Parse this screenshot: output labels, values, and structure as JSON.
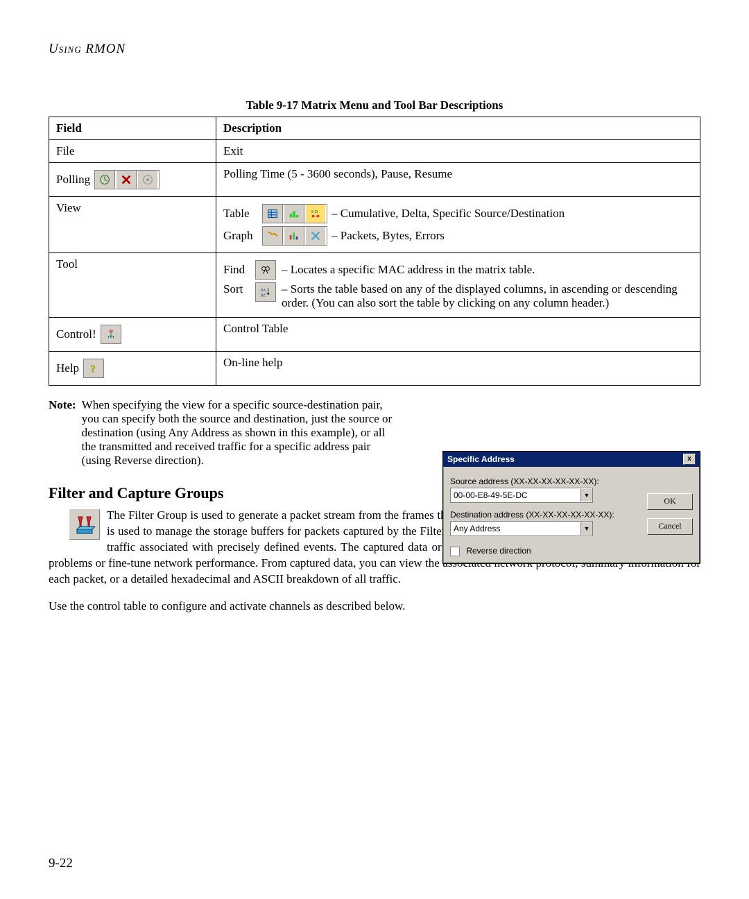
{
  "header": {
    "title": "Using RMON"
  },
  "table": {
    "caption": "Table 9-17  Matrix Menu and Tool Bar Descriptions",
    "headers": {
      "field": "Field",
      "description": "Description"
    },
    "rows": {
      "file": {
        "field": "File",
        "desc": "Exit"
      },
      "polling": {
        "field": "Polling",
        "desc": "Polling Time (5 - 3600 seconds), Pause, Resume"
      },
      "view": {
        "field": "View",
        "table_label": "Table",
        "table_desc": "– Cumulative, Delta, Specific Source/Destination",
        "graph_label": "Graph",
        "graph_desc": "– Packets, Bytes, Errors"
      },
      "tool": {
        "field": "Tool",
        "find_label": "Find",
        "find_desc": "– Locates a specific MAC address in the matrix table.",
        "sort_label": "Sort",
        "sort_desc": "– Sorts the table based on any of the displayed columns, in ascending or descending order. (You can also sort the table by clicking on any column header.)"
      },
      "control": {
        "field": "Control!",
        "desc": "Control Table"
      },
      "help": {
        "field": "Help",
        "desc": "On-line help"
      }
    }
  },
  "note": {
    "label": "Note:",
    "body": "When specifying the view for a specific source-destination pair, you can specify both the source and destination, just the source or destination (using Any Address as shown in this example), or all the transmitted and received traffic for a specific address pair (using Reverse direction)."
  },
  "dialog": {
    "title": "Specific Address",
    "close": "x",
    "src_label": "Source address (XX-XX-XX-XX-XX-XX):",
    "src_value": "00-00-E8-49-5E-DC",
    "dst_label": "Destination address (XX-XX-XX-XX-XX-XX):",
    "dst_value": "Any Address",
    "reverse_label": "Reverse direction",
    "ok": "OK",
    "cancel": "Cancel"
  },
  "section": {
    "title": "Filter and Capture Groups",
    "para1": "The Filter Group is used to generate a packet stream from the frames that match a specified pattern, while the Capture Group is used to manage the storage buffers for packets captured by the Filter Group. These groups can be used to capture network traffic associated with precisely defined events. The captured data or trigger events can then be used to debug application problems or fine-tune network performance. From captured data, you can view the associated network protocol, summary information for each packet, or a detailed hexadecimal and ASCII breakdown of all traffic.",
    "para2": "Use the control table to configure and activate channels as described below."
  },
  "page_number": "9-22"
}
